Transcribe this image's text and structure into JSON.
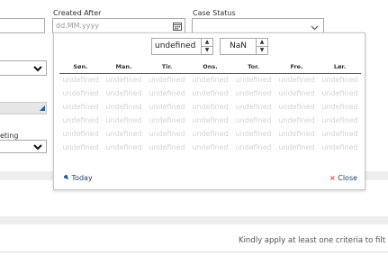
{
  "form": {
    "created_after_label": "Created After",
    "created_after_placeholder": "dd.MM.yyyy",
    "case_status_label": "Case Status",
    "meeting_label": "eting"
  },
  "datepicker": {
    "month_value": "undefined",
    "year_value": "NaN",
    "weekdays": [
      "Søn.",
      "Man.",
      "Tir.",
      "Ons.",
      "Tor.",
      "Fre.",
      "Lør."
    ],
    "weeks": [
      [
        "undefined",
        "undefined",
        "undefined",
        "undefined",
        "undefined",
        "undefined",
        "undefined"
      ],
      [
        "undefined",
        "undefined",
        "undefined",
        "undefined",
        "undefined",
        "undefined",
        "undefined"
      ],
      [
        "undefined",
        "undefined",
        "undefined",
        "undefined",
        "undefined",
        "undefined",
        "undefined"
      ],
      [
        "undefined",
        "undefined",
        "undefined",
        "undefined",
        "undefined",
        "undefined",
        "undefined"
      ],
      [
        "undefined",
        "undefined",
        "undefined",
        "undefined",
        "undefined",
        "undefined",
        "undefined"
      ],
      [
        "undefined",
        "undefined",
        "undefined",
        "undefined",
        "undefined",
        "undefined",
        "undefined"
      ]
    ],
    "today_label": "Today",
    "close_label": "Close"
  },
  "footer": {
    "notice": "Kindly apply at least one criteria to filt"
  },
  "colors": {
    "accent": "#1f5fa6",
    "close_x": "#d9433b",
    "band": "#eeeeee"
  }
}
